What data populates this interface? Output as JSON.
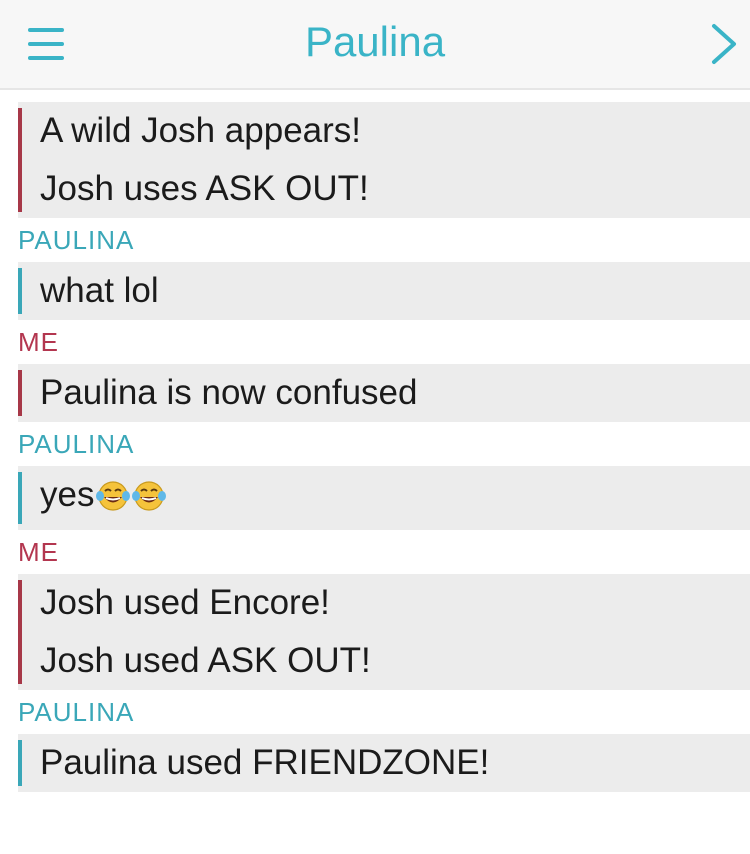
{
  "header": {
    "title": "Paulina",
    "menu_icon": "hamburger-menu-icon",
    "next_icon": "chevron-right-icon",
    "accent": "#3ab4c7"
  },
  "colors": {
    "me": "#b3364f",
    "paulina": "#3aa7b8",
    "bubble_bg": "#ececec",
    "text": "#1b1b1b"
  },
  "messages": [
    {
      "sender": "me",
      "sender_label": "",
      "lines": [
        "A wild Josh appears!",
        "Josh uses ASK OUT!"
      ]
    },
    {
      "sender": "paulina",
      "sender_label": "PAULINA",
      "lines": [
        "what lol"
      ]
    },
    {
      "sender": "me",
      "sender_label": "ME",
      "lines": [
        "Paulina is now confused"
      ]
    },
    {
      "sender": "paulina",
      "sender_label": "PAULINA",
      "lines": [
        "yes"
      ],
      "emojis": [
        "face-with-tears-of-joy-emoji",
        "face-with-tears-of-joy-emoji"
      ]
    },
    {
      "sender": "me",
      "sender_label": "ME",
      "lines": [
        "Josh used Encore!",
        "Josh used ASK OUT!"
      ]
    },
    {
      "sender": "paulina",
      "sender_label": "PAULINA",
      "lines": [
        "Paulina used FRIENDZONE!"
      ]
    }
  ]
}
